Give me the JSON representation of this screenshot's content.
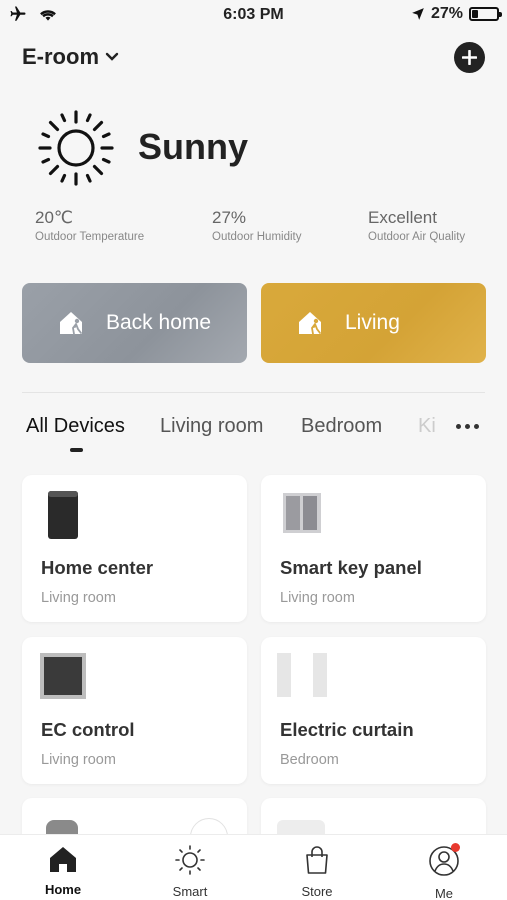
{
  "status_bar": {
    "time": "6:03 PM",
    "battery": "27%",
    "battery_level": 0.27
  },
  "header": {
    "home_name": "E-room",
    "icons": {
      "dropdown": "chevron-down-icon",
      "add": "plus-circle-icon"
    }
  },
  "weather": {
    "condition": "Sunny",
    "icon": "sun-icon",
    "stats": [
      {
        "value": "20℃",
        "label": "Outdoor Temperature"
      },
      {
        "value": "27%",
        "label": "Outdoor Humidity"
      },
      {
        "value": "Excellent",
        "label": "Outdoor Air Quality"
      }
    ]
  },
  "scenes": [
    {
      "label": "Back home",
      "icon": "home-walk-icon",
      "color": "#9aa0a8"
    },
    {
      "label": "Living",
      "icon": "home-walk-icon",
      "color": "#d9a93b"
    }
  ],
  "tabs": [
    {
      "label": "All Devices",
      "active": true
    },
    {
      "label": "Living room"
    },
    {
      "label": "Bedroom"
    },
    {
      "label": "Ki"
    }
  ],
  "devices": [
    {
      "name": "Home center",
      "room": "Living room"
    },
    {
      "name": "Smart key panel",
      "room": "Living room"
    },
    {
      "name": "EC control",
      "room": "Living room"
    },
    {
      "name": "Electric curtain",
      "room": "Bedroom"
    }
  ],
  "nav": [
    {
      "label": "Home",
      "icon": "home-icon",
      "active": true
    },
    {
      "label": "Smart",
      "icon": "sun-outline-icon"
    },
    {
      "label": "Store",
      "icon": "shopping-bag-icon"
    },
    {
      "label": "Me",
      "icon": "user-circle-icon",
      "badge": true
    }
  ]
}
